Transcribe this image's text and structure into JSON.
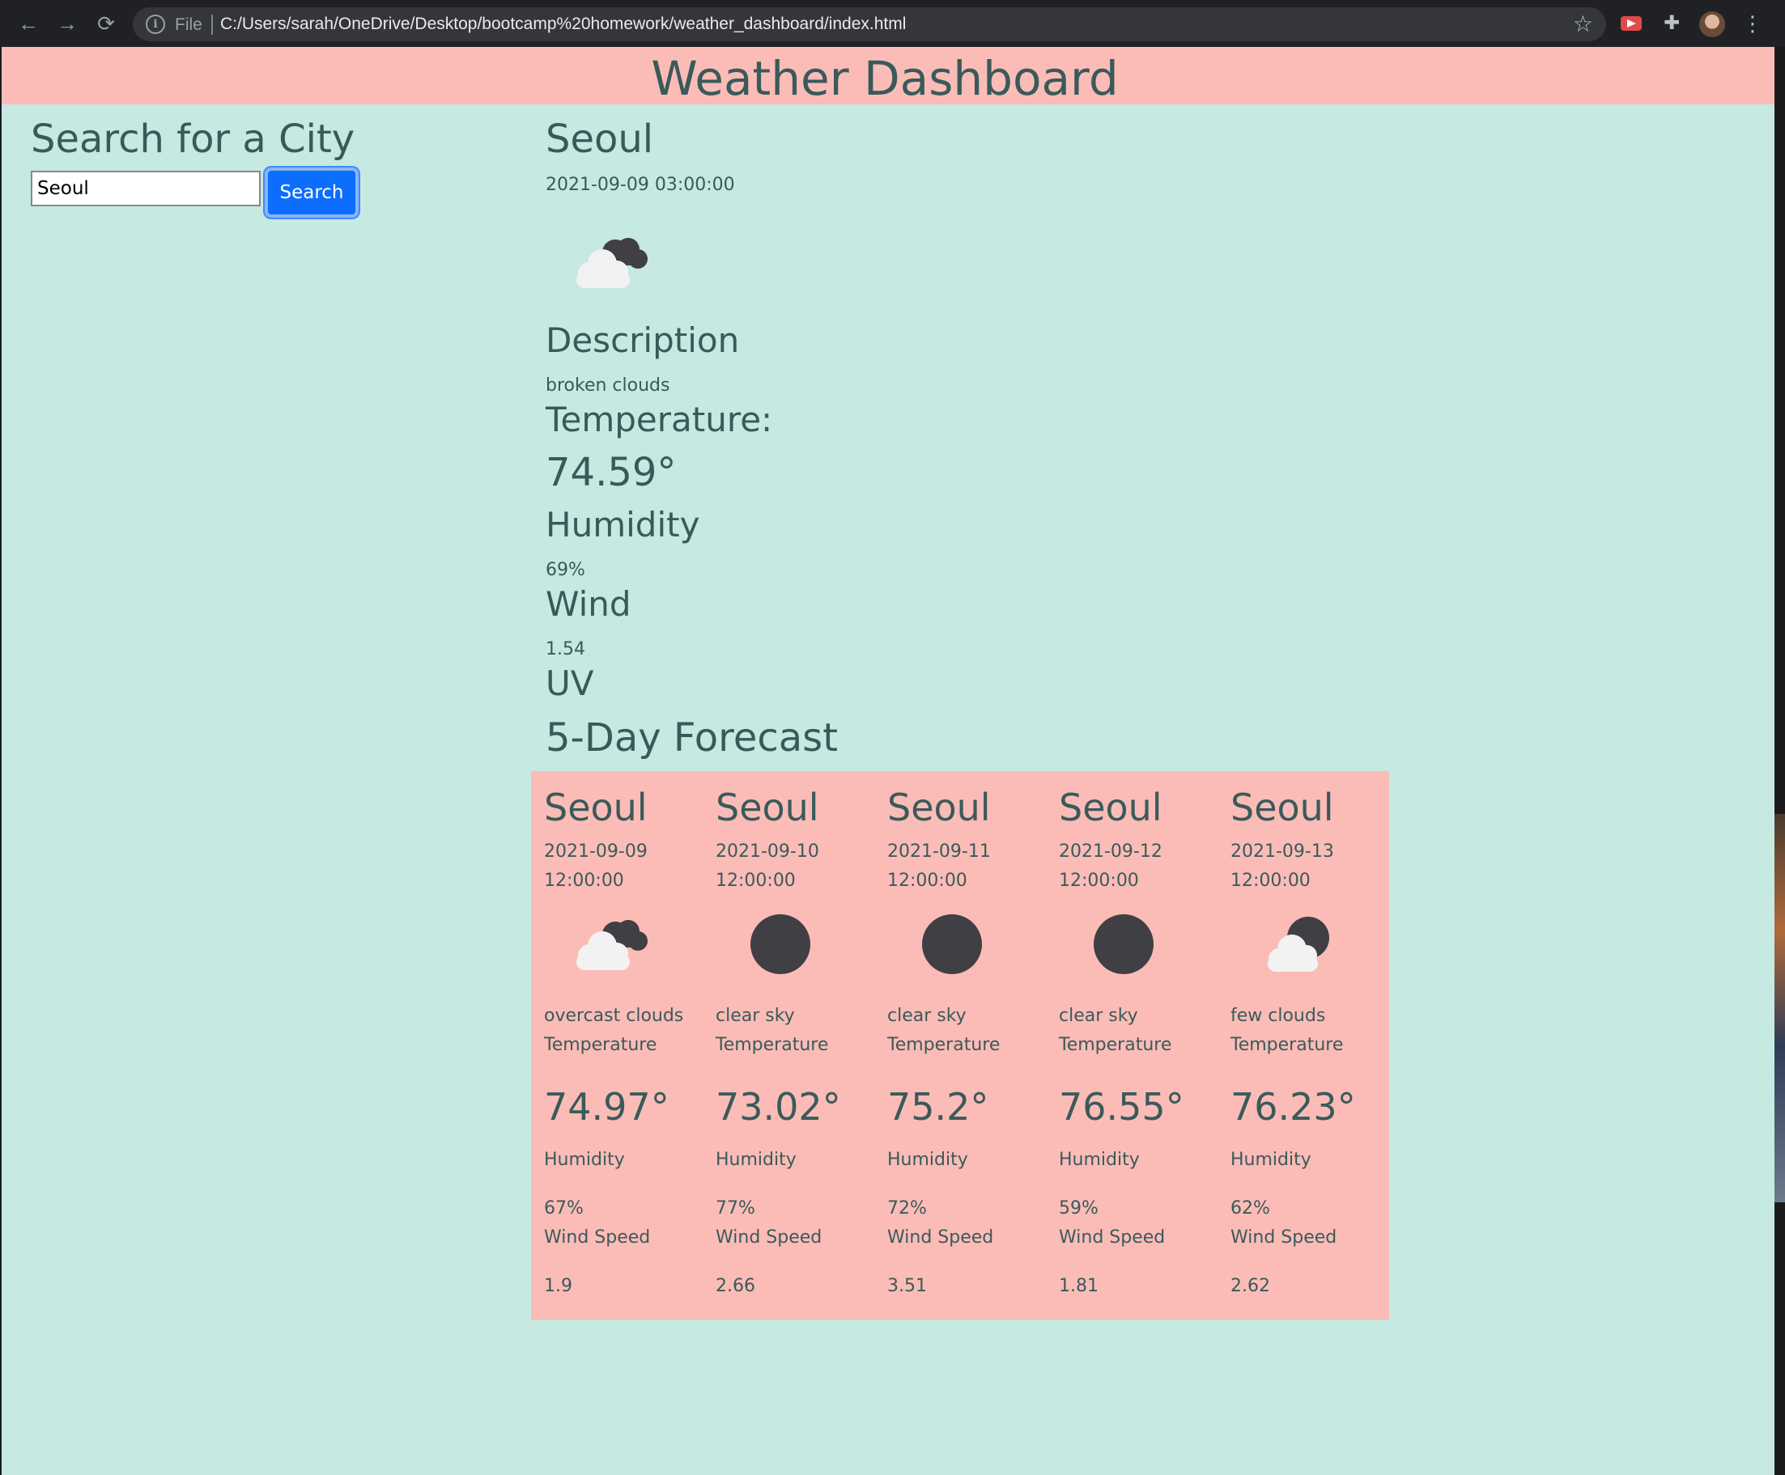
{
  "browser": {
    "scheme_label": "File",
    "url": "C:/Users/sarah/OneDrive/Desktop/bootcamp%20homework/weather_dashboard/index.html"
  },
  "header": {
    "title": "Weather Dashboard"
  },
  "search": {
    "heading": "Search for a City",
    "value": "Seoul",
    "button_label": "Search"
  },
  "current": {
    "city": "Seoul",
    "datetime": "2021-09-09 03:00:00",
    "icon": "broken-clouds-icon",
    "description_label": "Description",
    "description": "broken clouds",
    "temperature_label": "Temperature:",
    "temperature": "74.59°",
    "humidity_label": "Humidity",
    "humidity": "69%",
    "wind_label": "Wind",
    "wind": "1.54",
    "uv_label": "UV"
  },
  "forecast": {
    "heading": "5-Day Forecast",
    "temperature_label": "Temperature",
    "humidity_label": "Humidity",
    "wind_label": "Wind Speed",
    "days": [
      {
        "city": "Seoul",
        "date": "2021-09-09",
        "time": "12:00:00",
        "icon": "broken-clouds-icon",
        "description": "overcast clouds",
        "temperature": "74.97°",
        "humidity": "67%",
        "wind": "1.9"
      },
      {
        "city": "Seoul",
        "date": "2021-09-10",
        "time": "12:00:00",
        "icon": "clear-sky-icon",
        "description": "clear sky",
        "temperature": "73.02°",
        "humidity": "77%",
        "wind": "2.66"
      },
      {
        "city": "Seoul",
        "date": "2021-09-11",
        "time": "12:00:00",
        "icon": "clear-sky-icon",
        "description": "clear sky",
        "temperature": "75.2°",
        "humidity": "72%",
        "wind": "3.51"
      },
      {
        "city": "Seoul",
        "date": "2021-09-12",
        "time": "12:00:00",
        "icon": "clear-sky-icon",
        "description": "clear sky",
        "temperature": "76.55°",
        "humidity": "59%",
        "wind": "1.81"
      },
      {
        "city": "Seoul",
        "date": "2021-09-13",
        "time": "12:00:00",
        "icon": "few-clouds-icon",
        "description": "few clouds",
        "temperature": "76.23°",
        "humidity": "62%",
        "wind": "2.62"
      }
    ]
  },
  "colors": {
    "header_bg": "#fbbcb7",
    "page_bg": "#c6e9e2",
    "text": "#3a5a5a",
    "button": "#0d6efd"
  }
}
